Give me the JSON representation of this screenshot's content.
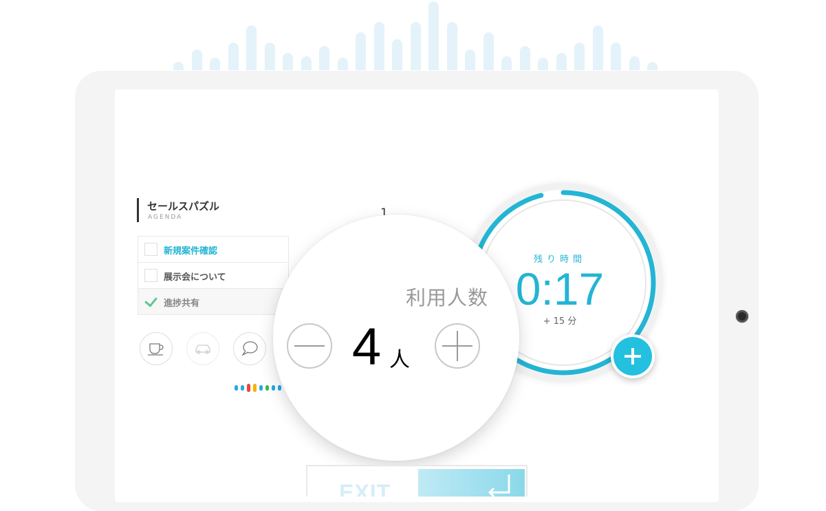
{
  "colors": {
    "accent": "#23b5d3",
    "accent_fab": "#23c0e0",
    "bars": "#e4f2fa",
    "check": "#5ec88a"
  },
  "background_bars": {
    "levels": [
      0.12,
      0.3,
      0.18,
      0.4,
      0.65,
      0.4,
      0.25,
      0.2,
      0.35,
      0.18,
      0.55,
      0.7,
      0.45,
      0.7,
      1.0,
      0.7,
      0.3,
      0.55,
      0.2,
      0.35,
      0.18,
      0.25,
      0.4,
      0.65,
      0.4,
      0.2,
      0.12
    ]
  },
  "agenda": {
    "title": "セールスパズル",
    "subtitle": "AGENDA",
    "page_indicator": "1",
    "items": [
      {
        "label": "新規案件確認",
        "checked": false,
        "active": true
      },
      {
        "label": "展示会について",
        "checked": false,
        "active": false
      },
      {
        "label": "進捗共有",
        "checked": true,
        "active": false
      }
    ],
    "icons": [
      "coffee-cup-icon",
      "car-icon",
      "chat-bubble-icon"
    ]
  },
  "voice_dots": {
    "colors": [
      "#2aa7e0",
      "#2aa7e0",
      "#e34a3a",
      "#f4b400",
      "#2aa7e0",
      "#3cba54",
      "#2aa7e0",
      "#2aa7e0"
    ]
  },
  "timer": {
    "label": "残り時間",
    "value": "0:17",
    "add_label": "+ 15 分",
    "progress": 0.96,
    "add_button_icon": "plus-icon"
  },
  "capacity": {
    "label": "利用人数",
    "count": "4",
    "unit": "人",
    "decrement_icon": "minus-icon",
    "increment_icon": "plus-icon"
  },
  "exit": {
    "label": "EXIT",
    "icon": "return-arrow-icon"
  }
}
